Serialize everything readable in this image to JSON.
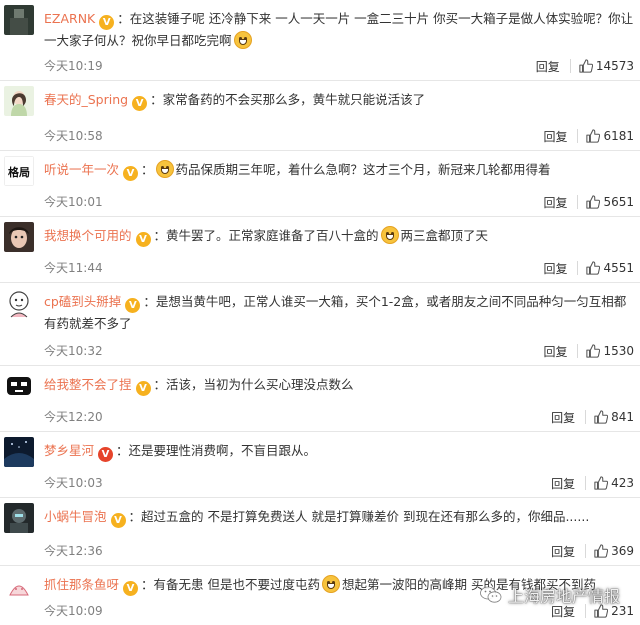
{
  "comments": [
    {
      "username": "EZARNK",
      "segments": [
        "在这装锤子呢 还冷静下来 一人一天一片 一盒二三十片 你买一大箱子是做人体实验呢？你让一大家子何从？祝你早日都吃完啊",
        ""
      ],
      "time": "今天10:19",
      "reply_label": "回复",
      "likes": "14573"
    },
    {
      "username": "春天的_Spring",
      "segments": [
        "家常备药的不会买那么多，黄牛就只能说活该了"
      ],
      "time": "今天10:58",
      "reply_label": "回复",
      "likes": "6181"
    },
    {
      "username": "听说一年一次",
      "segments": [
        "",
        "药品保质期三年呢，着什么急啊？这才三个月，新冠来几轮都用得着"
      ],
      "time": "今天10:01",
      "reply_label": "回复",
      "likes": "5651"
    },
    {
      "username": "我想换个可用的",
      "segments": [
        "黄牛罢了。正常家庭谁备了百八十盒的",
        "两三盒都顶了天"
      ],
      "time": "今天11:44",
      "reply_label": "回复",
      "likes": "4551"
    },
    {
      "username": "cp磕到头掰掉",
      "segments": [
        "是想当黄牛吧，正常人谁买一大箱，买个1-2盒，或者朋友之间不同品种匀一匀互相都有药就差不多了"
      ],
      "time": "今天10:32",
      "reply_label": "回复",
      "likes": "1530"
    },
    {
      "username": "给我整不会了捏",
      "segments": [
        "活该，当初为什么买心理没点数么"
      ],
      "time": "今天12:20",
      "reply_label": "回复",
      "likes": "841"
    },
    {
      "username": "梦乡星河",
      "segments": [
        "还是要理性消费啊，不盲目跟从。"
      ],
      "time": "今天10:03",
      "reply_label": "回复",
      "likes": "423"
    },
    {
      "username": "小蜗牛冒泡",
      "segments": [
        "超过五盒的 不是打算免费送人 就是打算赚差价 到现在还有那么多的，你细品......"
      ],
      "time": "今天12:36",
      "reply_label": "回复",
      "likes": "369"
    },
    {
      "username": "抓住那条鱼呀",
      "segments": [
        "有备无患 但是也不要过度屯药",
        "想起第一波阳的高峰期 买的是有钱都买不到药"
      ],
      "time": "今天10:09",
      "reply_label": "回复",
      "likes": "231"
    }
  ],
  "watermark": "上海房地产情报",
  "colors": {
    "username": "#eb7350",
    "badge_gold": "#f6b11f",
    "badge_red": "#e6442b",
    "timestamp": "#808080"
  },
  "icons": {
    "verified_badge": "gold-v-badge-icon",
    "like": "thumbs-up-icon",
    "emoji": "grin-emoji-icon",
    "watermark": "wechat-logo-icon"
  }
}
